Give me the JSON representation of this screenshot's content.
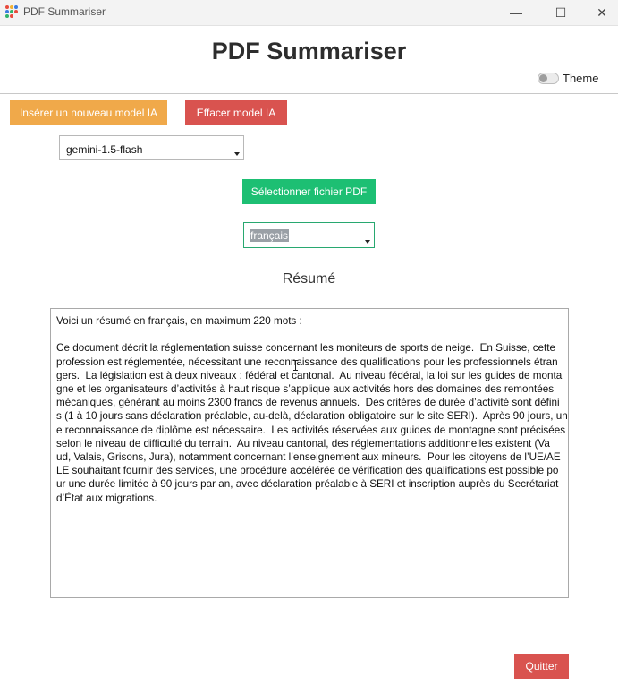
{
  "window": {
    "title": "PDF Summariser",
    "controls": {
      "minimize": "—",
      "maximize": "☐",
      "close": "✕"
    }
  },
  "header": {
    "title": "PDF Summariser",
    "theme_label": "Theme"
  },
  "toolbar": {
    "insert_model_label": "Insérer un nouveau model IA",
    "clear_model_label": "Effacer model IA"
  },
  "model_select": {
    "value": "gemini-1.5-flash"
  },
  "select_pdf_label": "Sélectionner fichier PDF",
  "language_select": {
    "value": "français"
  },
  "summary": {
    "heading": "Résumé",
    "lines": [
      "Voici un résumé en français, en maximum 220 mots :",
      "",
      "Ce document décrit la réglementation suisse concernant les moniteurs de sports de neige.  En Suisse, cette",
      "profession est réglementée, nécessitant une reconnaissance des qualifications pour les professionnels étran",
      "gers.  La législation est à deux niveaux : fédéral et cantonal.  Au niveau fédéral, la loi sur les guides de monta",
      "gne et les organisateurs d’activités à haut risque s’applique aux activités hors des domaines des remontées",
      "mécaniques, générant au moins 2300 francs de revenus annuels.  Des critères de durée d’activité sont défini",
      "s (1 à 10 jours sans déclaration préalable, au-delà, déclaration obligatoire sur le site SERI).  Après 90 jours, un",
      "e reconnaissance de diplôme est nécessaire.  Les activités réservées aux guides de montagne sont précisées",
      "selon le niveau de difficulté du terrain.  Au niveau cantonal, des réglementations additionnelles existent (Va",
      "ud, Valais, Grisons, Jura), notamment concernant l’enseignement aux mineurs.  Pour les citoyens de l’UE/AE",
      "LE souhaitant fournir des services, une procédure accélérée de vérification des qualifications est possible po",
      "ur une durée limitée à 90 jours par an, avec déclaration préalable à SERI et inscription auprès du Secrétariat",
      "d’État aux migrations."
    ]
  },
  "footer": {
    "quit_label": "Quitter"
  },
  "colors": {
    "insert_button": "#f0a94a",
    "danger_button": "#d9534f",
    "primary_button": "#1dbf73",
    "selection_highlight": "#9aa0a6"
  }
}
